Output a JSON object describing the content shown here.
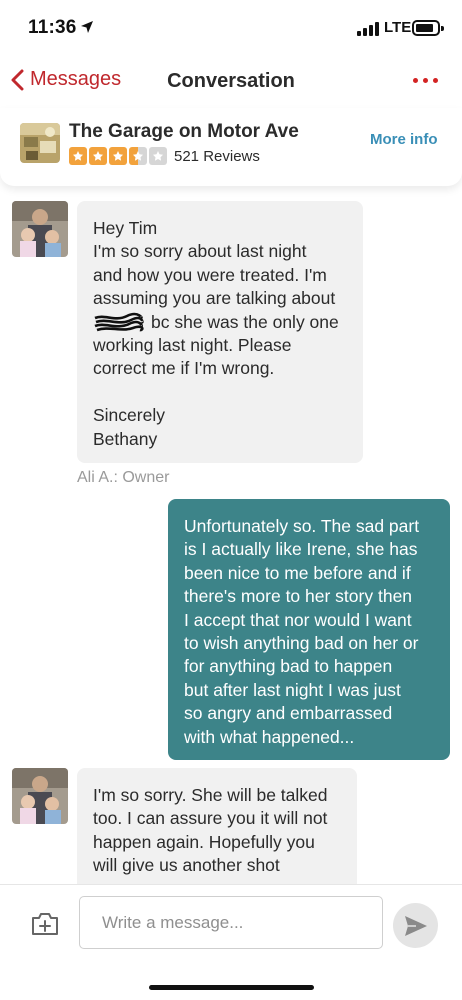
{
  "status_bar": {
    "time": "11:36",
    "network": "LTE"
  },
  "nav": {
    "back_label": "Messages",
    "title": "Conversation"
  },
  "business": {
    "name": "The Garage on Motor Ave",
    "rating": 3.5,
    "reviews": "521 Reviews",
    "more_info_label": "More info"
  },
  "messages": [
    {
      "direction": "incoming",
      "lines": [
        "Hey Tim",
        "I'm so sorry about last night",
        "and how you were treated. I'm",
        "assuming you are talking about",
        "bc she was the only one",
        "working last night. Please",
        "correct me if I'm wrong."
      ],
      "signoff": [
        "Sincerely",
        "Bethany"
      ],
      "sender": "Ali A.: Owner"
    },
    {
      "direction": "outgoing",
      "lines": [
        "Unfortunately so. The sad part",
        "is I actually like Irene, she has",
        "been nice to me before and if",
        "there's more to her story then",
        "I accept that nor would I want",
        "to wish anything bad on her or",
        "for anything bad to happen",
        "but after last night I was just",
        "so angry and embarrassed",
        "with what happened..."
      ]
    },
    {
      "direction": "incoming",
      "lines": [
        "I'm so sorry. She will be talked",
        "too. I can assure you it will not",
        "happen again. Hopefully you",
        "will give us another shot"
      ]
    }
  ],
  "composer": {
    "placeholder": "Write a message..."
  },
  "colors": {
    "accent_red": "#d32323",
    "link_blue": "#3a8fb7",
    "outgoing_bubble": "#3d8489",
    "star_orange": "#f2a23c"
  },
  "icons": [
    "location-arrow-icon",
    "signal-icon",
    "battery-icon",
    "chevron-left-icon",
    "more-dots-icon",
    "star-icon",
    "camera-plus-icon",
    "send-icon"
  ]
}
